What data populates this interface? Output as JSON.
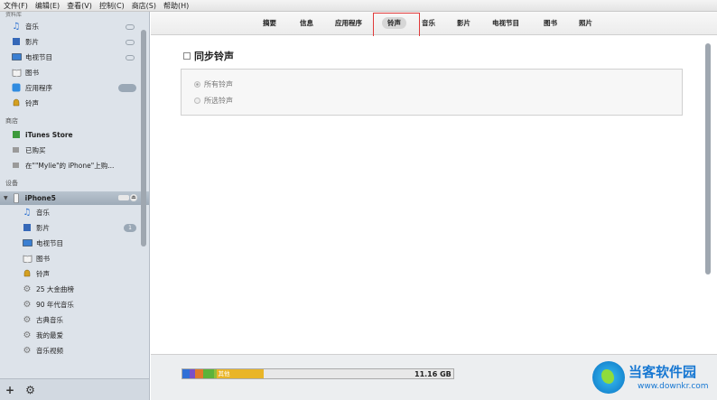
{
  "menu": [
    "文件(F)",
    "编辑(E)",
    "查看(V)",
    "控制(C)",
    "商店(S)",
    "帮助(H)"
  ],
  "sidebar": {
    "library_header": "资料库",
    "library": [
      {
        "label": "音乐",
        "icon": "music-note-icon",
        "badge": "cloud"
      },
      {
        "label": "影片",
        "icon": "film-icon",
        "badge": "cloud"
      },
      {
        "label": "电视节目",
        "icon": "tv-icon",
        "badge": "cloud"
      },
      {
        "label": "图书",
        "icon": "book-icon",
        "badge": ""
      },
      {
        "label": "应用程序",
        "icon": "app-store-icon",
        "badge": "pill"
      },
      {
        "label": "铃声",
        "icon": "bell-icon",
        "badge": ""
      }
    ],
    "store_header": "商店",
    "store": [
      {
        "label": "iTunes Store",
        "icon": "itunes-store-icon"
      },
      {
        "label": "已购买",
        "icon": "purchased-icon"
      },
      {
        "label": "在\"\"Mylie\"的 iPhone\"上购...",
        "icon": "purchased-on-device-icon"
      }
    ],
    "devices_header": "设备",
    "device_name": "iPhone5",
    "device_items": [
      {
        "label": "音乐",
        "icon": "music-note-icon",
        "badge": ""
      },
      {
        "label": "影片",
        "icon": "film-icon",
        "badge": "1"
      },
      {
        "label": "电视节目",
        "icon": "tv-icon",
        "badge": ""
      },
      {
        "label": "图书",
        "icon": "book-icon",
        "badge": ""
      },
      {
        "label": "铃声",
        "icon": "bell-icon",
        "badge": ""
      },
      {
        "label": "25 大金曲榜",
        "icon": "smart-playlist-gear-icon",
        "badge": ""
      },
      {
        "label": "90 年代音乐",
        "icon": "smart-playlist-gear-icon",
        "badge": ""
      },
      {
        "label": "古典音乐",
        "icon": "smart-playlist-gear-icon",
        "badge": ""
      },
      {
        "label": "我的最爱",
        "icon": "smart-playlist-gear-icon",
        "badge": ""
      },
      {
        "label": "音乐视频",
        "icon": "smart-playlist-gear-icon",
        "badge": ""
      }
    ],
    "bottom_add": "+",
    "bottom_settings": "⚙"
  },
  "tabs": [
    {
      "label": "摘要",
      "active": false
    },
    {
      "label": "信息",
      "active": false
    },
    {
      "label": "应用程序",
      "active": false
    },
    {
      "label": "铃声",
      "active": true
    },
    {
      "label": "音乐",
      "active": false
    },
    {
      "label": "影片",
      "active": false
    },
    {
      "label": "电视节目",
      "active": false
    },
    {
      "label": "图书",
      "active": false
    },
    {
      "label": "照片",
      "active": false
    }
  ],
  "main": {
    "sync_label": "同步铃声",
    "sync_checked": false,
    "options": [
      {
        "label": "所有铃声",
        "selected": true
      },
      {
        "label": "所选铃声",
        "selected": false
      }
    ]
  },
  "capacity": {
    "other_label": "其他",
    "free_text": "11.16 GB",
    "segments": [
      {
        "name": "audio",
        "color": "#2f6fd6",
        "fraction": 0.025
      },
      {
        "name": "video",
        "color": "#7b4fc8",
        "fraction": 0.02
      },
      {
        "name": "photos",
        "color": "#e07a2b",
        "fraction": 0.03
      },
      {
        "name": "apps",
        "color": "#5bb33a",
        "fraction": 0.04
      },
      {
        "name": "books",
        "color": "#8fbf3a",
        "fraction": 0.01
      },
      {
        "name": "other",
        "color": "#e9b527",
        "fraction": 0.175
      }
    ]
  },
  "watermark": {
    "title": "当客软件园",
    "url": "www.downkr.com"
  },
  "colors": {
    "highlight_box": "#e03a3a",
    "sidebar_bg": "#dde3ea"
  }
}
